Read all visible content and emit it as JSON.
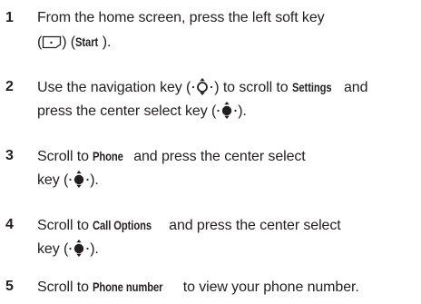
{
  "steps": [
    {
      "number": "1",
      "line1_text": "From the home screen, press the left soft key",
      "line2_open": "(",
      "line2_mid": ") (",
      "line2_term": "Start",
      "line2_close": ")."
    },
    {
      "number": "2",
      "line1_pre": "Use the navigation key (",
      "line1_mid": ") to scroll to ",
      "line1_term": "Settings",
      "line1_post": " and",
      "line2_pre": "press the center select key (",
      "line2_post": ")."
    },
    {
      "number": "3",
      "line1_pre": "Scroll to ",
      "line1_term": "Phone",
      "line1_post": " and press the center select",
      "line2_pre": "key (",
      "line2_post": ")."
    },
    {
      "number": "4",
      "line1_pre": "Scroll to ",
      "line1_term": "Call Options",
      "line1_post": " and press the center select",
      "line2_pre": "key (",
      "line2_post": ")."
    },
    {
      "number": "5",
      "line1_pre": "Scroll to ",
      "line1_term": "Phone number",
      "line1_post": " to view your phone number."
    }
  ]
}
